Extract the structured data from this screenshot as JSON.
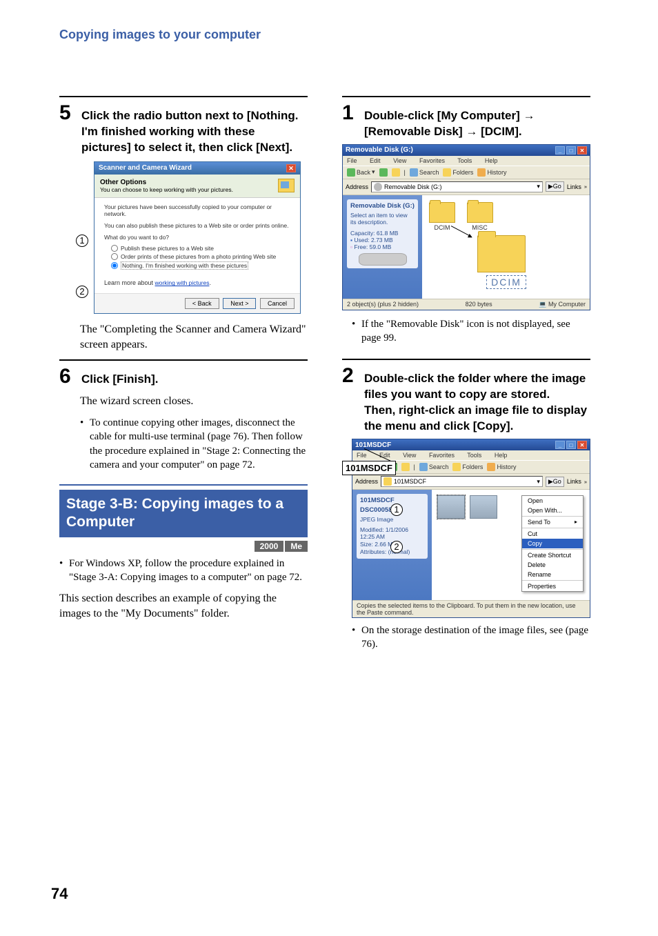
{
  "header": {
    "title": "Copying images to your computer"
  },
  "page_number": "74",
  "col_left": {
    "step5": {
      "num": "5",
      "text": "Click the radio button next to [Nothing. I'm finished working with these pictures] to select it, then click [Next].",
      "after_text": "The \"Completing the Scanner and Camera Wizard\" screen appears.",
      "wizard": {
        "title": "Scanner and Camera Wizard",
        "banner_title": "Other Options",
        "banner_sub": "You can choose to keep working with your pictures.",
        "line1": "Your pictures have been successfully copied to your computer or network.",
        "line2": "You can also publish these pictures to a Web site or order prints online.",
        "question": "What do you want to do?",
        "radio1": "Publish these pictures to a Web site",
        "radio2": "Order prints of these pictures from a photo printing Web site",
        "radio3": "Nothing. I'm finished working with these pictures",
        "link_pre": "Learn more about ",
        "link": "working with pictures",
        "btn_back": "< Back",
        "btn_next": "Next >",
        "btn_cancel": "Cancel"
      },
      "callout1": "1",
      "callout2": "2"
    },
    "step6": {
      "num": "6",
      "text": "Click [Finish].",
      "after_text": "The wizard screen closes.",
      "bullet": "To continue copying other images, disconnect the cable for multi-use terminal (page 76). Then follow the procedure explained in \"Stage 2: Connecting the camera and your computer\" on page 72."
    },
    "stage": {
      "title": "Stage 3-B: Copying images to a Computer",
      "badge1": "2000",
      "badge2": "Me",
      "bullet": "For Windows XP, follow the procedure explained in \"Stage 3-A: Copying images to a computer\" on page 72.",
      "after_text": "This section describes an example of copying the images to the \"My Documents\" folder."
    }
  },
  "col_right": {
    "step1": {
      "num": "1",
      "text_a": "Double-click [My Computer] ",
      "text_b": "[Removable Disk] ",
      "text_c": " [DCIM].",
      "explorer": {
        "title": "Removable Disk (G:)",
        "menu": {
          "file": "File",
          "edit": "Edit",
          "view": "View",
          "fav": "Favorites",
          "tools": "Tools",
          "help": "Help"
        },
        "tool": {
          "back": "Back",
          "search": "Search",
          "folders": "Folders",
          "history": "History"
        },
        "addr_label": "Address",
        "addr_value": "Removable Disk (G:)",
        "go": "Go",
        "links": "Links",
        "side": {
          "name": "Removable Disk (G:)",
          "select": "Select an item to view its description.",
          "capacity_l": "Capacity:",
          "capacity_v": "61.8 MB",
          "used_l": "Used:",
          "used_v": "2.73 MB",
          "free_l": "Free:",
          "free_v": "59.0 MB"
        },
        "folders": {
          "dcim": "DCIM",
          "misc": "MISC"
        },
        "dcim_label": "DCIM",
        "status_left": "2 object(s) (plus 2 hidden)",
        "status_mid": "820 bytes",
        "status_right": "My Computer"
      },
      "bullet": "If the \"Removable Disk\" icon is not displayed, see page 99."
    },
    "step2": {
      "num": "2",
      "text": "Double-click the folder where the image files you want to copy are stored.\nThen, right-click an image file to display the menu and click [Copy].",
      "label101": "101MSDCF",
      "callout1": "1",
      "callout2": "2",
      "explorer": {
        "title": "101MSDCF",
        "menu": {
          "file": "File",
          "edit": "Edit",
          "view": "View",
          "fav": "Favorites",
          "tools": "Tools",
          "help": "Help"
        },
        "tool": {
          "back": "Back",
          "search": "Search",
          "folders": "Folders",
          "history": "History"
        },
        "addr_label": "Address",
        "addr_value": "101MSDCF",
        "go": "Go",
        "links": "Links",
        "side": {
          "name": "101MSDCF",
          "file": "DSC00058",
          "type": "JPEG Image",
          "mod_l": "Modified:",
          "mod_v": "1/1/2006 12:25 AM",
          "size_l": "Size:",
          "size_v": "2.66 MB",
          "attr_l": "Attributes:",
          "attr_v": "(normal)"
        },
        "ctx": {
          "open": "Open",
          "openwith": "Open With...",
          "sendto": "Send To",
          "cut": "Cut",
          "copy": "Copy",
          "shortcut": "Create Shortcut",
          "delete": "Delete",
          "rename": "Rename",
          "props": "Properties"
        },
        "status": "Copies the selected items to the Clipboard. To put them in the new location, use the Paste command."
      },
      "bullet": "On the storage destination of the image files, see (page 76)."
    }
  }
}
